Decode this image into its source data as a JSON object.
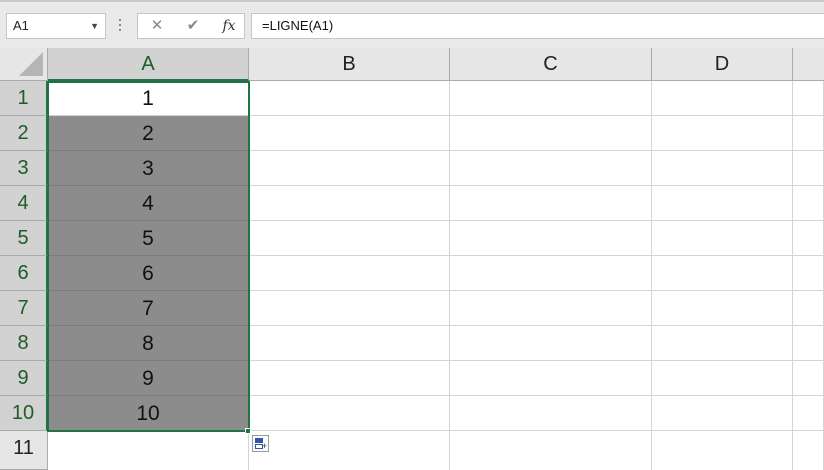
{
  "formula_bar": {
    "name_box": "A1",
    "name_box_dropdown": "▼",
    "cancel": "✕",
    "enter": "✔",
    "fx": "fx",
    "formula": "=LIGNE(A1)"
  },
  "columns": [
    "A",
    "B",
    "C",
    "D"
  ],
  "rows": [
    "1",
    "2",
    "3",
    "4",
    "5",
    "6",
    "7",
    "8",
    "9",
    "10",
    "11"
  ],
  "column_a_values": [
    "1",
    "2",
    "3",
    "4",
    "5",
    "6",
    "7",
    "8",
    "9",
    "10"
  ],
  "colors": {
    "selection": "#217346",
    "selected_fill": "#8c8c8c",
    "header": "#e6e6e6"
  },
  "icons": {
    "quick_analysis": "quick-analysis-icon"
  }
}
